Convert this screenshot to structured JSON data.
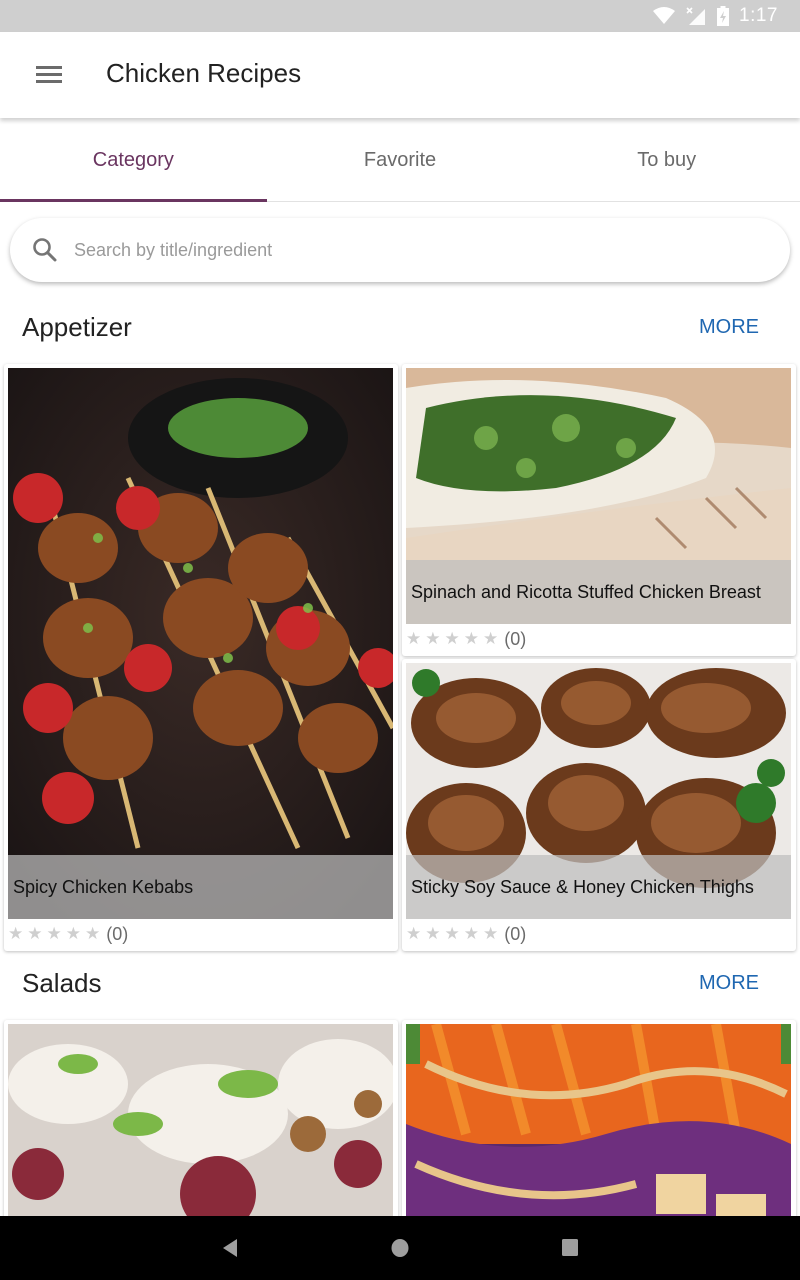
{
  "status_bar": {
    "time": "1:17",
    "icons": [
      "wifi-icon",
      "cell-signal-off-icon",
      "battery-charging-icon"
    ]
  },
  "app_bar": {
    "menu_icon": "menu-icon",
    "title": "Chicken Recipes"
  },
  "tabs": [
    {
      "label": "Category",
      "active": true
    },
    {
      "label": "Favorite",
      "active": false
    },
    {
      "label": "To buy",
      "active": false
    }
  ],
  "search": {
    "icon": "search-icon",
    "placeholder": "Search by title/ingredient",
    "value": ""
  },
  "sections": [
    {
      "name": "Appetizer",
      "more_label": "MORE",
      "recipes": [
        {
          "title": "Spicy Chicken Kebabs",
          "rating": 0,
          "max_rating": 5,
          "review_count": "(0)"
        },
        {
          "title": "Spinach and Ricotta Stuffed Chicken Breast",
          "rating": 0,
          "max_rating": 5,
          "review_count": "(0)"
        },
        {
          "title": "Sticky Soy Sauce & Honey Chicken Thighs",
          "rating": 0,
          "max_rating": 5,
          "review_count": "(0)"
        }
      ]
    },
    {
      "name": "Salads",
      "more_label": "MORE",
      "recipes": [
        {
          "title": "",
          "rating": 0,
          "max_rating": 5,
          "review_count": ""
        },
        {
          "title": "",
          "rating": 0,
          "max_rating": 5,
          "review_count": ""
        }
      ]
    }
  ],
  "nav_bar": {
    "buttons": [
      "back-icon",
      "home-icon",
      "recents-icon"
    ]
  },
  "colors": {
    "accent": "#6a3560",
    "link": "#1f67b1",
    "status_bar": "#cfcfcf",
    "star_empty": "#cfcfcf"
  }
}
